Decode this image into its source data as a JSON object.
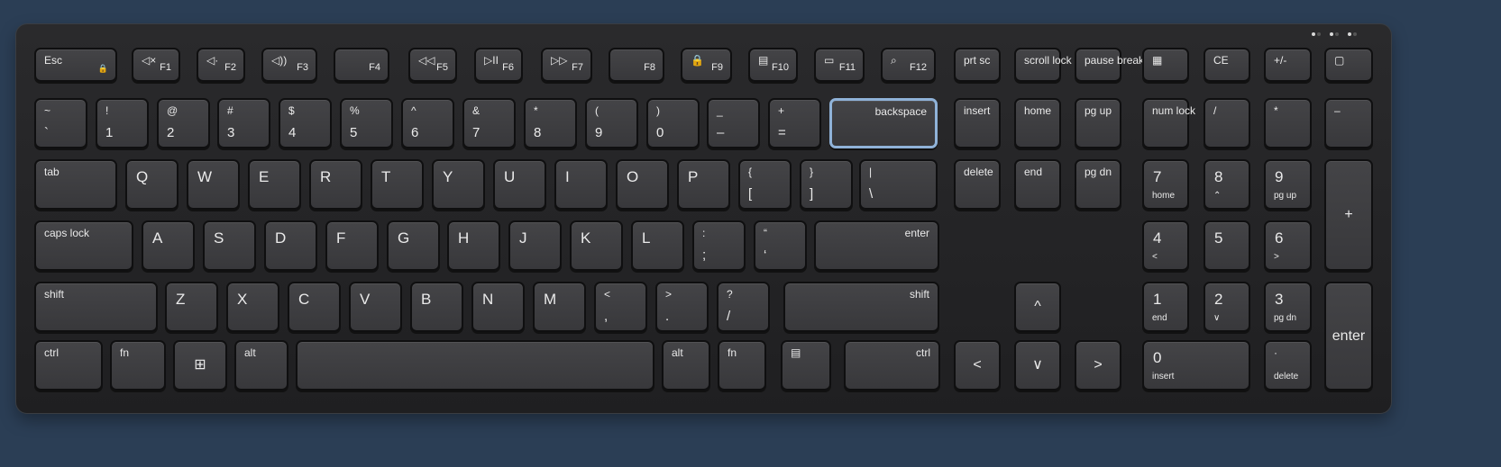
{
  "keyboard": {
    "colors": {
      "background": "#2b3e55",
      "keycap": "#404043",
      "legend": "#eaeaea",
      "selection_outline": "#8fb2d8"
    },
    "selected_key": "backspace",
    "rows": {
      "function": [
        {
          "id": "esc",
          "top": "Esc",
          "icon": "lock-icon"
        },
        {
          "id": "f1",
          "top": "◁×",
          "sub": "F1",
          "icon": "mute-icon"
        },
        {
          "id": "f2",
          "top": "◁·",
          "sub": "F2",
          "icon": "volume-down-icon"
        },
        {
          "id": "f3",
          "top": "◁))",
          "sub": "F3",
          "icon": "volume-up-icon"
        },
        {
          "id": "f4",
          "sub": "F4"
        },
        {
          "id": "f5",
          "top": "◁◁",
          "sub": "F5",
          "icon": "previous-track-icon"
        },
        {
          "id": "f6",
          "top": "▷II",
          "sub": "F6",
          "icon": "play-pause-icon"
        },
        {
          "id": "f7",
          "top": "▷▷",
          "sub": "F7",
          "icon": "next-track-icon"
        },
        {
          "id": "f8",
          "sub": "F8"
        },
        {
          "id": "f9",
          "top": "🔒",
          "sub": "F9",
          "icon": "lock-screen-icon"
        },
        {
          "id": "f10",
          "top": "▤",
          "sub": "F10",
          "icon": "task-view-icon"
        },
        {
          "id": "f11",
          "top": "▭",
          "sub": "F11",
          "icon": "screenshot-icon"
        },
        {
          "id": "f12",
          "top": "⌕",
          "sub": "F12",
          "icon": "search-icon"
        },
        {
          "id": "prtsc",
          "top": "prt sc"
        },
        {
          "id": "scroll-lock",
          "top": "scroll lock"
        },
        {
          "id": "pause-break",
          "top": "pause break"
        },
        {
          "id": "calculator",
          "top": "▦",
          "icon": "calculator-icon"
        },
        {
          "id": "ce",
          "top": "CE"
        },
        {
          "id": "plus-minus",
          "top": "+/-"
        },
        {
          "id": "chat",
          "top": "▢",
          "icon": "chat-icon"
        }
      ],
      "number": [
        {
          "id": "tilde",
          "top": "~",
          "bottom": "`"
        },
        {
          "id": "1",
          "top": "!",
          "bottom": "1"
        },
        {
          "id": "2",
          "top": "@",
          "bottom": "2"
        },
        {
          "id": "3",
          "top": "#",
          "bottom": "3"
        },
        {
          "id": "4",
          "top": "$",
          "bottom": "4"
        },
        {
          "id": "5",
          "top": "%",
          "bottom": "5"
        },
        {
          "id": "6",
          "top": "^",
          "bottom": "6"
        },
        {
          "id": "7",
          "top": "&",
          "bottom": "7"
        },
        {
          "id": "8",
          "top": "*",
          "bottom": "8"
        },
        {
          "id": "9",
          "top": "(",
          "bottom": "9"
        },
        {
          "id": "0",
          "top": ")",
          "bottom": "0"
        },
        {
          "id": "minus",
          "top": "_",
          "bottom": "–"
        },
        {
          "id": "equals",
          "top": "+",
          "bottom": "="
        },
        {
          "id": "backspace",
          "top": "backspace"
        },
        {
          "id": "insert",
          "top": "insert"
        },
        {
          "id": "home",
          "top": "home"
        },
        {
          "id": "pgup",
          "top": "pg up"
        },
        {
          "id": "numlock",
          "top": "num lock"
        },
        {
          "id": "num-div",
          "top": "/"
        },
        {
          "id": "num-mul",
          "top": "*"
        },
        {
          "id": "num-sub",
          "top": "–"
        }
      ],
      "qwerty": [
        {
          "id": "tab",
          "top": "tab"
        },
        {
          "id": "q",
          "top": "Q"
        },
        {
          "id": "w",
          "top": "W"
        },
        {
          "id": "e",
          "top": "E"
        },
        {
          "id": "r",
          "top": "R"
        },
        {
          "id": "t",
          "top": "T"
        },
        {
          "id": "y",
          "top": "Y"
        },
        {
          "id": "u",
          "top": "U"
        },
        {
          "id": "i",
          "top": "I"
        },
        {
          "id": "o",
          "top": "O"
        },
        {
          "id": "p",
          "top": "P"
        },
        {
          "id": "lbracket",
          "top": "{",
          "bottom": "["
        },
        {
          "id": "rbracket",
          "top": "}",
          "bottom": "]"
        },
        {
          "id": "backslash",
          "top": "|",
          "bottom": "\\"
        },
        {
          "id": "delete",
          "top": "delete"
        },
        {
          "id": "end",
          "top": "end"
        },
        {
          "id": "pgdn",
          "top": "pg dn"
        },
        {
          "id": "num7",
          "top": "7",
          "bottom": "home"
        },
        {
          "id": "num8",
          "top": "8",
          "bottom": "⌃",
          "icon": "arrow-up-icon"
        },
        {
          "id": "num9",
          "top": "9",
          "bottom": "pg up"
        },
        {
          "id": "num-add",
          "top": "+"
        }
      ],
      "home": [
        {
          "id": "capslock",
          "top": "caps lock"
        },
        {
          "id": "a",
          "top": "A"
        },
        {
          "id": "s",
          "top": "S"
        },
        {
          "id": "d",
          "top": "D"
        },
        {
          "id": "f",
          "top": "F"
        },
        {
          "id": "g",
          "top": "G"
        },
        {
          "id": "h",
          "top": "H"
        },
        {
          "id": "j",
          "top": "J"
        },
        {
          "id": "k",
          "top": "K"
        },
        {
          "id": "l",
          "top": "L"
        },
        {
          "id": "semicolon",
          "top": ":",
          "bottom": ";"
        },
        {
          "id": "quote",
          "top": "“",
          "bottom": "‘"
        },
        {
          "id": "enter",
          "top": "enter"
        },
        {
          "id": "num4",
          "top": "4",
          "bottom": "<",
          "icon": "arrow-left-icon"
        },
        {
          "id": "num5",
          "top": "5"
        },
        {
          "id": "num6",
          "top": "6",
          "bottom": ">",
          "icon": "arrow-right-icon"
        }
      ],
      "shift": [
        {
          "id": "lshift",
          "top": "shift"
        },
        {
          "id": "z",
          "top": "Z"
        },
        {
          "id": "x",
          "top": "X"
        },
        {
          "id": "c",
          "top": "C"
        },
        {
          "id": "v",
          "top": "V"
        },
        {
          "id": "b",
          "top": "B"
        },
        {
          "id": "n",
          "top": "N"
        },
        {
          "id": "m",
          "top": "M"
        },
        {
          "id": "comma",
          "top": "<",
          "bottom": ","
        },
        {
          "id": "period",
          "top": ">",
          "bottom": "."
        },
        {
          "id": "slash",
          "top": "?",
          "bottom": "/"
        },
        {
          "id": "rshift",
          "top": "shift"
        },
        {
          "id": "up",
          "top": "^",
          "icon": "arrow-up-icon"
        },
        {
          "id": "num1",
          "top": "1",
          "bottom": "end"
        },
        {
          "id": "num2",
          "top": "2",
          "bottom": "∨",
          "icon": "arrow-down-icon"
        },
        {
          "id": "num3",
          "top": "3",
          "bottom": "pg dn"
        },
        {
          "id": "num-enter",
          "top": "enter"
        }
      ],
      "bottom": [
        {
          "id": "lctrl",
          "top": "ctrl"
        },
        {
          "id": "lfn",
          "top": "fn"
        },
        {
          "id": "win",
          "top": "⊞",
          "icon": "windows-logo-icon"
        },
        {
          "id": "lalt",
          "top": "alt"
        },
        {
          "id": "space",
          "top": ""
        },
        {
          "id": "ralt",
          "top": "alt"
        },
        {
          "id": "rfn",
          "top": "fn"
        },
        {
          "id": "menu",
          "top": "▤",
          "icon": "context-menu-icon"
        },
        {
          "id": "rctrl",
          "top": "ctrl"
        },
        {
          "id": "left",
          "top": "<",
          "icon": "arrow-left-icon"
        },
        {
          "id": "down",
          "top": "∨",
          "icon": "arrow-down-icon"
        },
        {
          "id": "right",
          "top": ">",
          "icon": "arrow-right-icon"
        },
        {
          "id": "num0",
          "top": "0",
          "bottom": "insert"
        },
        {
          "id": "num-dec",
          "top": "·",
          "bottom": "delete"
        }
      ]
    }
  }
}
